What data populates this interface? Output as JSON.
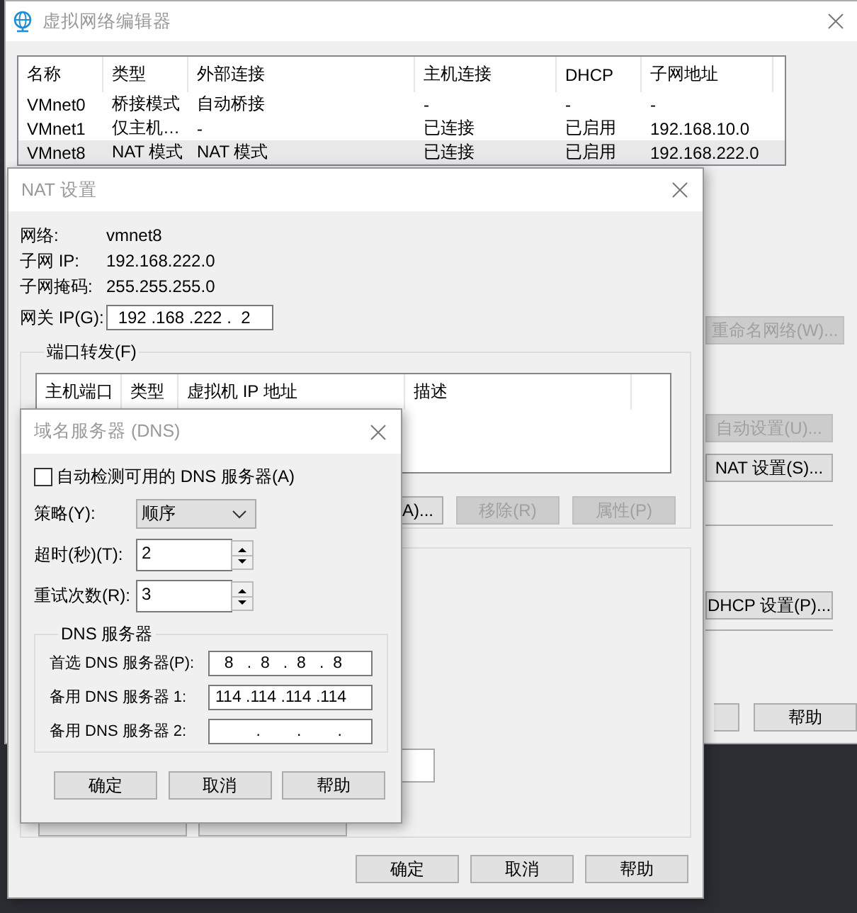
{
  "main_window": {
    "title": "虚拟网络编辑器",
    "table": {
      "columns": [
        "名称",
        "类型",
        "外部连接",
        "主机连接",
        "DHCP",
        "子网地址"
      ],
      "rows": [
        {
          "cells": [
            "VMnet0",
            "桥接模式",
            "自动桥接",
            "-",
            "-",
            "-"
          ],
          "selected": false
        },
        {
          "cells": [
            "VMnet1",
            "仅主机…",
            "-",
            "已连接",
            "已启用",
            "192.168.10.0"
          ],
          "selected": false
        },
        {
          "cells": [
            "VMnet8",
            "NAT 模式",
            "NAT 模式",
            "已连接",
            "已启用",
            "192.168.222.0"
          ],
          "selected": true
        }
      ]
    },
    "side_buttons": [
      {
        "label": "重命名网络(W)...",
        "disabled": true
      },
      {
        "label": "自动设置(U)...",
        "disabled": true
      },
      {
        "label": "NAT 设置(S)...",
        "disabled": false
      },
      {
        "label": "DHCP 设置(P)...",
        "disabled": false
      }
    ],
    "help_button": {
      "label": "帮助",
      "disabled": false
    }
  },
  "nat_window": {
    "title": "NAT 设置",
    "info": [
      {
        "label": "网络:",
        "value": "vmnet8"
      },
      {
        "label": "子网 IP:",
        "value": "192.168.222.0"
      },
      {
        "label": "子网掩码:",
        "value": "255.255.255.0"
      }
    ],
    "gateway": {
      "label": "网关 IP(G):",
      "value": " 192 .168 .222 .  2"
    },
    "port_forwarding": {
      "title": "端口转发(F)",
      "columns": [
        "主机端口",
        "类型",
        "虚拟机 IP 地址",
        "描述"
      ],
      "buttons": [
        {
          "label": "A)...",
          "disabled": false
        },
        {
          "label": "移除(R)",
          "disabled": true
        },
        {
          "label": "属性(P)",
          "disabled": true
        }
      ]
    },
    "buttons": [
      {
        "label": "确定",
        "disabled": false
      },
      {
        "label": "取消",
        "disabled": false
      },
      {
        "label": "帮助",
        "disabled": false
      }
    ]
  },
  "dns_dialog": {
    "title": "域名服务器 (DNS)",
    "auto_detect": {
      "label": "自动检测可用的 DNS 服务器(A)",
      "checked": false
    },
    "policy": {
      "label": "策略(Y):",
      "value": "顺序"
    },
    "timeout": {
      "label": "超时(秒)(T):",
      "value": "2"
    },
    "retries": {
      "label": "重试次数(R):",
      "value": "3"
    },
    "servers": {
      "title": "DNS 服务器",
      "rows": [
        {
          "label": "首选 DNS 服务器(P):",
          "value": "  8   .  8   .  8   .  8"
        },
        {
          "label": "备用 DNS 服务器 1:",
          "value": "114 .114 .114 .114"
        },
        {
          "label": "备用 DNS 服务器 2:",
          "value": "         .        .        ."
        }
      ]
    },
    "buttons": [
      {
        "label": "确定",
        "disabled": false
      },
      {
        "label": "取消",
        "disabled": false
      },
      {
        "label": "帮助",
        "disabled": false
      }
    ]
  }
}
